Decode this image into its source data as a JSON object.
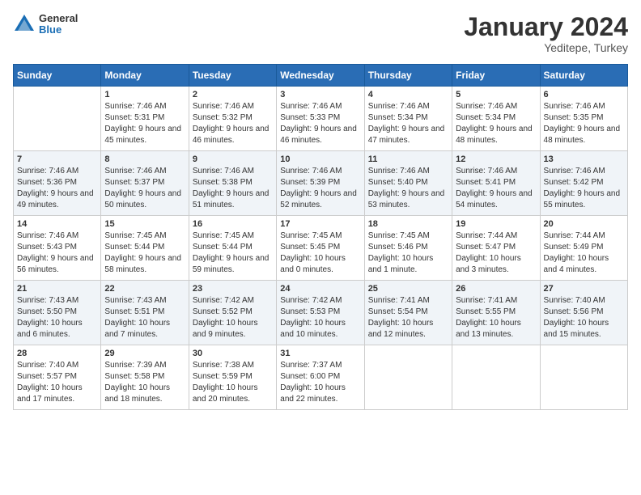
{
  "logo": {
    "general": "General",
    "blue": "Blue"
  },
  "title": "January 2024",
  "location": "Yeditepe, Turkey",
  "days_of_week": [
    "Sunday",
    "Monday",
    "Tuesday",
    "Wednesday",
    "Thursday",
    "Friday",
    "Saturday"
  ],
  "weeks": [
    [
      {
        "day": "",
        "sunrise": "",
        "sunset": "",
        "daylight": ""
      },
      {
        "day": "1",
        "sunrise": "Sunrise: 7:46 AM",
        "sunset": "Sunset: 5:31 PM",
        "daylight": "Daylight: 9 hours and 45 minutes."
      },
      {
        "day": "2",
        "sunrise": "Sunrise: 7:46 AM",
        "sunset": "Sunset: 5:32 PM",
        "daylight": "Daylight: 9 hours and 46 minutes."
      },
      {
        "day": "3",
        "sunrise": "Sunrise: 7:46 AM",
        "sunset": "Sunset: 5:33 PM",
        "daylight": "Daylight: 9 hours and 46 minutes."
      },
      {
        "day": "4",
        "sunrise": "Sunrise: 7:46 AM",
        "sunset": "Sunset: 5:34 PM",
        "daylight": "Daylight: 9 hours and 47 minutes."
      },
      {
        "day": "5",
        "sunrise": "Sunrise: 7:46 AM",
        "sunset": "Sunset: 5:34 PM",
        "daylight": "Daylight: 9 hours and 48 minutes."
      },
      {
        "day": "6",
        "sunrise": "Sunrise: 7:46 AM",
        "sunset": "Sunset: 5:35 PM",
        "daylight": "Daylight: 9 hours and 48 minutes."
      }
    ],
    [
      {
        "day": "7",
        "sunrise": "Sunrise: 7:46 AM",
        "sunset": "Sunset: 5:36 PM",
        "daylight": "Daylight: 9 hours and 49 minutes."
      },
      {
        "day": "8",
        "sunrise": "Sunrise: 7:46 AM",
        "sunset": "Sunset: 5:37 PM",
        "daylight": "Daylight: 9 hours and 50 minutes."
      },
      {
        "day": "9",
        "sunrise": "Sunrise: 7:46 AM",
        "sunset": "Sunset: 5:38 PM",
        "daylight": "Daylight: 9 hours and 51 minutes."
      },
      {
        "day": "10",
        "sunrise": "Sunrise: 7:46 AM",
        "sunset": "Sunset: 5:39 PM",
        "daylight": "Daylight: 9 hours and 52 minutes."
      },
      {
        "day": "11",
        "sunrise": "Sunrise: 7:46 AM",
        "sunset": "Sunset: 5:40 PM",
        "daylight": "Daylight: 9 hours and 53 minutes."
      },
      {
        "day": "12",
        "sunrise": "Sunrise: 7:46 AM",
        "sunset": "Sunset: 5:41 PM",
        "daylight": "Daylight: 9 hours and 54 minutes."
      },
      {
        "day": "13",
        "sunrise": "Sunrise: 7:46 AM",
        "sunset": "Sunset: 5:42 PM",
        "daylight": "Daylight: 9 hours and 55 minutes."
      }
    ],
    [
      {
        "day": "14",
        "sunrise": "Sunrise: 7:46 AM",
        "sunset": "Sunset: 5:43 PM",
        "daylight": "Daylight: 9 hours and 56 minutes."
      },
      {
        "day": "15",
        "sunrise": "Sunrise: 7:45 AM",
        "sunset": "Sunset: 5:44 PM",
        "daylight": "Daylight: 9 hours and 58 minutes."
      },
      {
        "day": "16",
        "sunrise": "Sunrise: 7:45 AM",
        "sunset": "Sunset: 5:44 PM",
        "daylight": "Daylight: 9 hours and 59 minutes."
      },
      {
        "day": "17",
        "sunrise": "Sunrise: 7:45 AM",
        "sunset": "Sunset: 5:45 PM",
        "daylight": "Daylight: 10 hours and 0 minutes."
      },
      {
        "day": "18",
        "sunrise": "Sunrise: 7:45 AM",
        "sunset": "Sunset: 5:46 PM",
        "daylight": "Daylight: 10 hours and 1 minute."
      },
      {
        "day": "19",
        "sunrise": "Sunrise: 7:44 AM",
        "sunset": "Sunset: 5:47 PM",
        "daylight": "Daylight: 10 hours and 3 minutes."
      },
      {
        "day": "20",
        "sunrise": "Sunrise: 7:44 AM",
        "sunset": "Sunset: 5:49 PM",
        "daylight": "Daylight: 10 hours and 4 minutes."
      }
    ],
    [
      {
        "day": "21",
        "sunrise": "Sunrise: 7:43 AM",
        "sunset": "Sunset: 5:50 PM",
        "daylight": "Daylight: 10 hours and 6 minutes."
      },
      {
        "day": "22",
        "sunrise": "Sunrise: 7:43 AM",
        "sunset": "Sunset: 5:51 PM",
        "daylight": "Daylight: 10 hours and 7 minutes."
      },
      {
        "day": "23",
        "sunrise": "Sunrise: 7:42 AM",
        "sunset": "Sunset: 5:52 PM",
        "daylight": "Daylight: 10 hours and 9 minutes."
      },
      {
        "day": "24",
        "sunrise": "Sunrise: 7:42 AM",
        "sunset": "Sunset: 5:53 PM",
        "daylight": "Daylight: 10 hours and 10 minutes."
      },
      {
        "day": "25",
        "sunrise": "Sunrise: 7:41 AM",
        "sunset": "Sunset: 5:54 PM",
        "daylight": "Daylight: 10 hours and 12 minutes."
      },
      {
        "day": "26",
        "sunrise": "Sunrise: 7:41 AM",
        "sunset": "Sunset: 5:55 PM",
        "daylight": "Daylight: 10 hours and 13 minutes."
      },
      {
        "day": "27",
        "sunrise": "Sunrise: 7:40 AM",
        "sunset": "Sunset: 5:56 PM",
        "daylight": "Daylight: 10 hours and 15 minutes."
      }
    ],
    [
      {
        "day": "28",
        "sunrise": "Sunrise: 7:40 AM",
        "sunset": "Sunset: 5:57 PM",
        "daylight": "Daylight: 10 hours and 17 minutes."
      },
      {
        "day": "29",
        "sunrise": "Sunrise: 7:39 AM",
        "sunset": "Sunset: 5:58 PM",
        "daylight": "Daylight: 10 hours and 18 minutes."
      },
      {
        "day": "30",
        "sunrise": "Sunrise: 7:38 AM",
        "sunset": "Sunset: 5:59 PM",
        "daylight": "Daylight: 10 hours and 20 minutes."
      },
      {
        "day": "31",
        "sunrise": "Sunrise: 7:37 AM",
        "sunset": "Sunset: 6:00 PM",
        "daylight": "Daylight: 10 hours and 22 minutes."
      },
      {
        "day": "",
        "sunrise": "",
        "sunset": "",
        "daylight": ""
      },
      {
        "day": "",
        "sunrise": "",
        "sunset": "",
        "daylight": ""
      },
      {
        "day": "",
        "sunrise": "",
        "sunset": "",
        "daylight": ""
      }
    ]
  ]
}
